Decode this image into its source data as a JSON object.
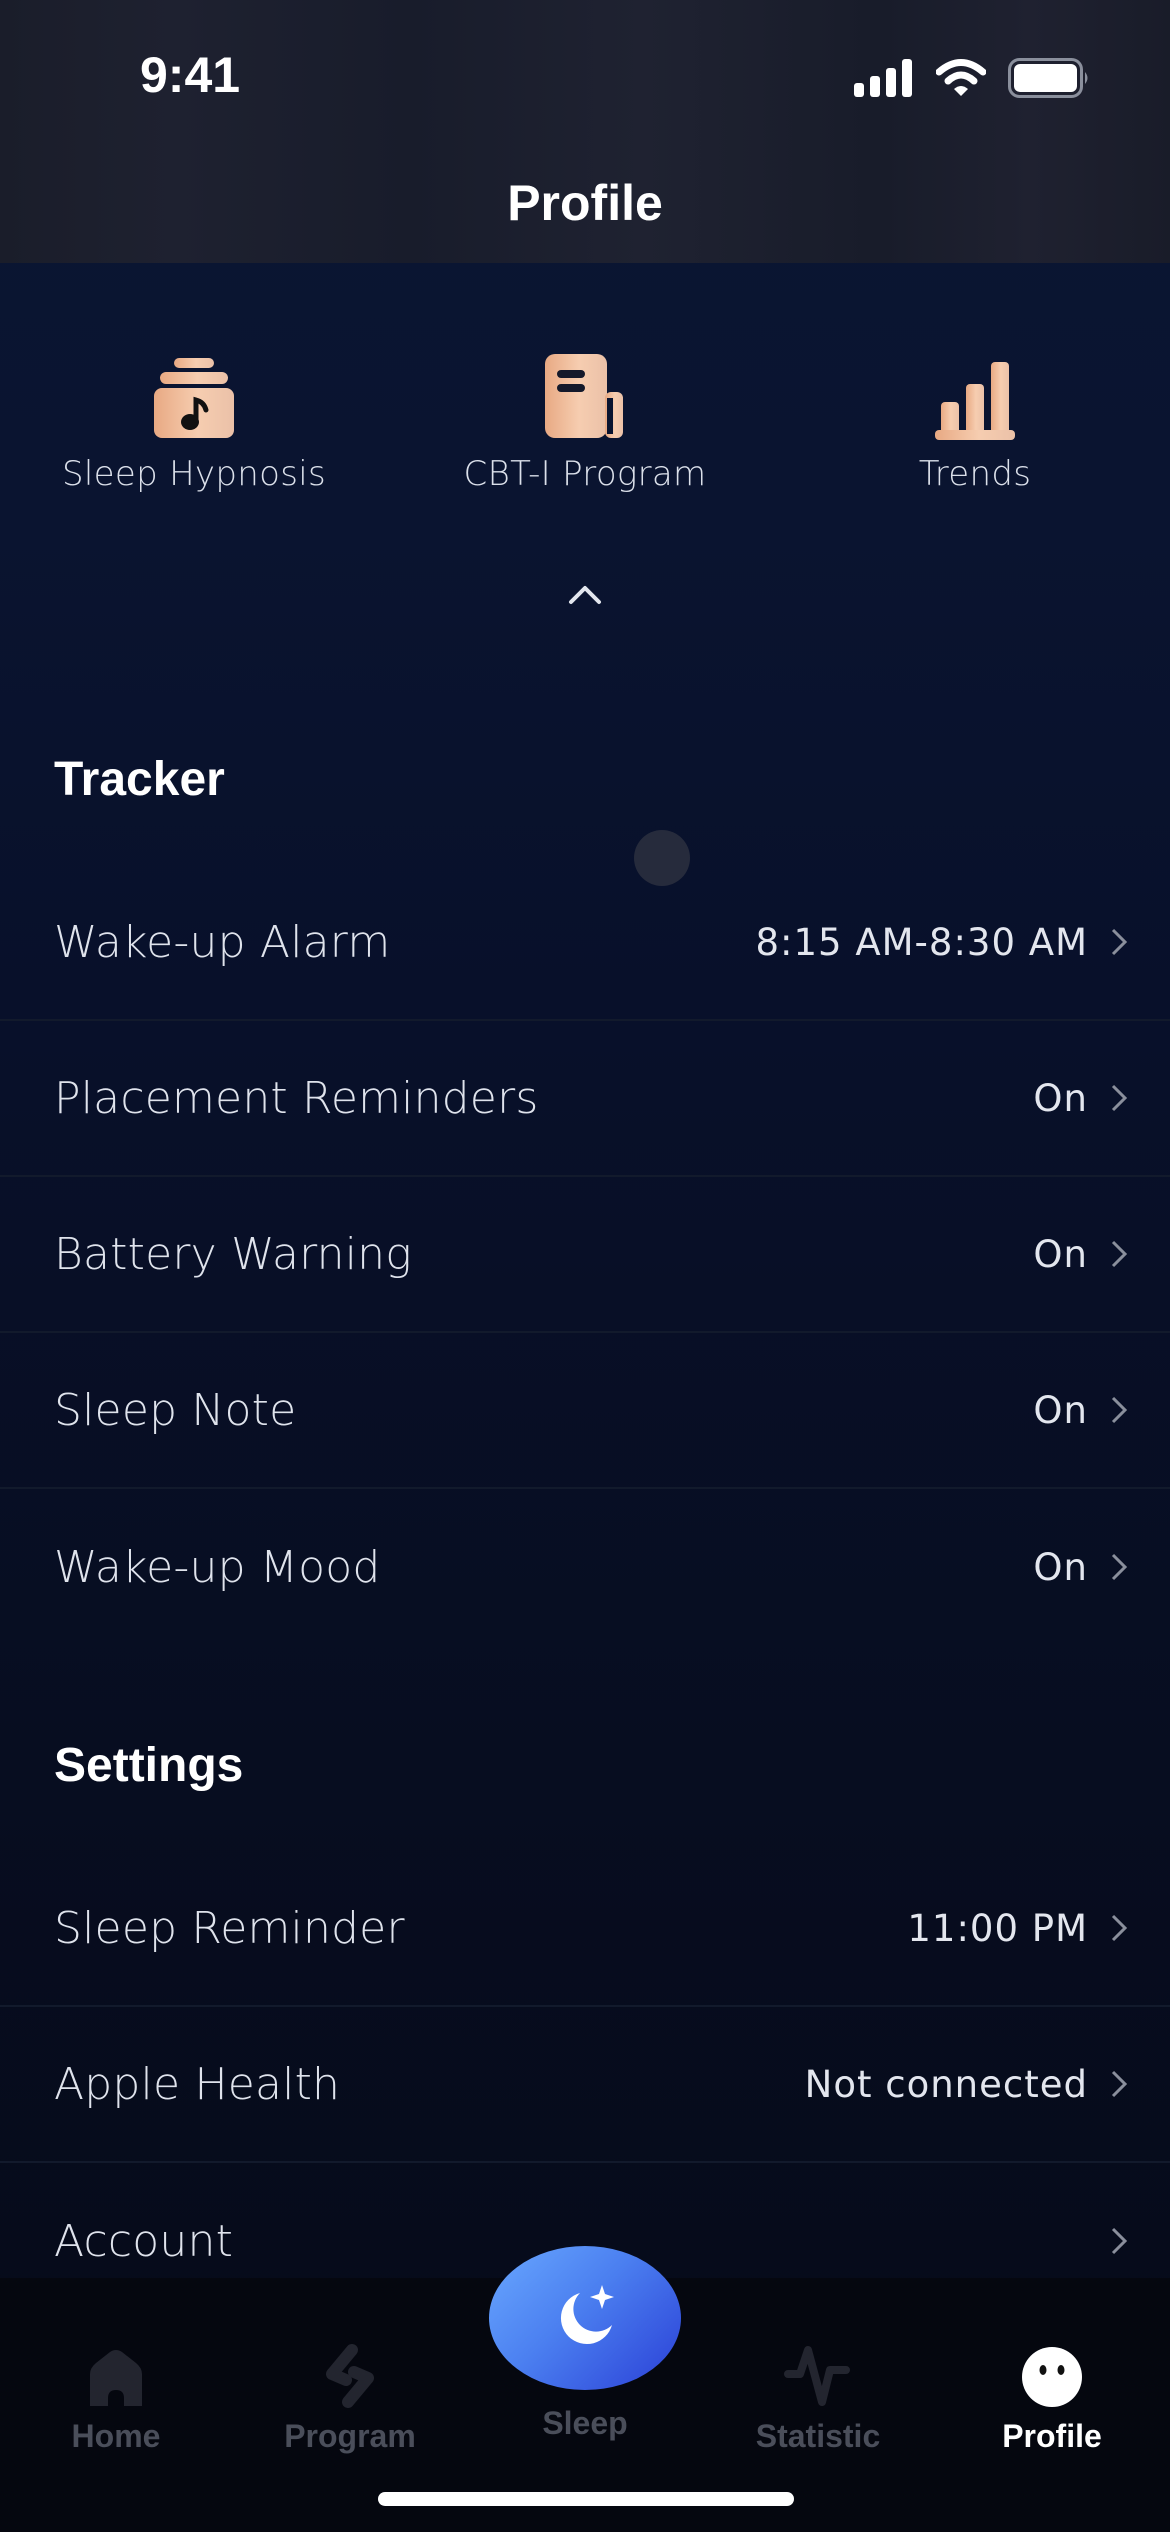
{
  "status_bar": {
    "time": "9:41",
    "icons": [
      "signal-icon",
      "wifi-icon",
      "battery-icon"
    ]
  },
  "header": {
    "title": "Profile"
  },
  "shortcuts": [
    {
      "label": "Sleep Hypnosis",
      "icon": "music-jar-icon"
    },
    {
      "label": "CBT-I Program",
      "icon": "notebook-icon"
    },
    {
      "label": "Trends",
      "icon": "bar-chart-icon"
    }
  ],
  "collapse_icon": "chevron-up-icon",
  "tracker": {
    "title": "Tracker",
    "rows": [
      {
        "label": "Wake-up Alarm",
        "value": "8:15 AM-8:30 AM"
      },
      {
        "label": "Placement Reminders",
        "value": "On"
      },
      {
        "label": "Battery Warning",
        "value": "On"
      },
      {
        "label": "Sleep Note",
        "value": "On"
      },
      {
        "label": "Wake-up Mood",
        "value": "On"
      }
    ]
  },
  "settings": {
    "title": "Settings",
    "rows": [
      {
        "label": "Sleep Reminder",
        "value": "11:00 PM"
      },
      {
        "label": "Apple Health",
        "value": "Not connected"
      },
      {
        "label": "Account",
        "value": ""
      }
    ]
  },
  "tabbar": {
    "tabs": [
      {
        "label": "Home",
        "icon": "home-icon",
        "active": false
      },
      {
        "label": "Program",
        "icon": "program-icon",
        "active": false
      },
      {
        "label": "Sleep",
        "icon": "moon-star-icon",
        "active": false
      },
      {
        "label": "Statistic",
        "icon": "pulse-icon",
        "active": false
      },
      {
        "label": "Profile",
        "icon": "face-icon",
        "active": true
      }
    ]
  },
  "colors": {
    "accent_gradient_start": "#69a8ff",
    "accent_gradient_end": "#2a3fd6",
    "icon_peach": "#f3c3a0",
    "inactive_tab": "#4a4e5a"
  }
}
